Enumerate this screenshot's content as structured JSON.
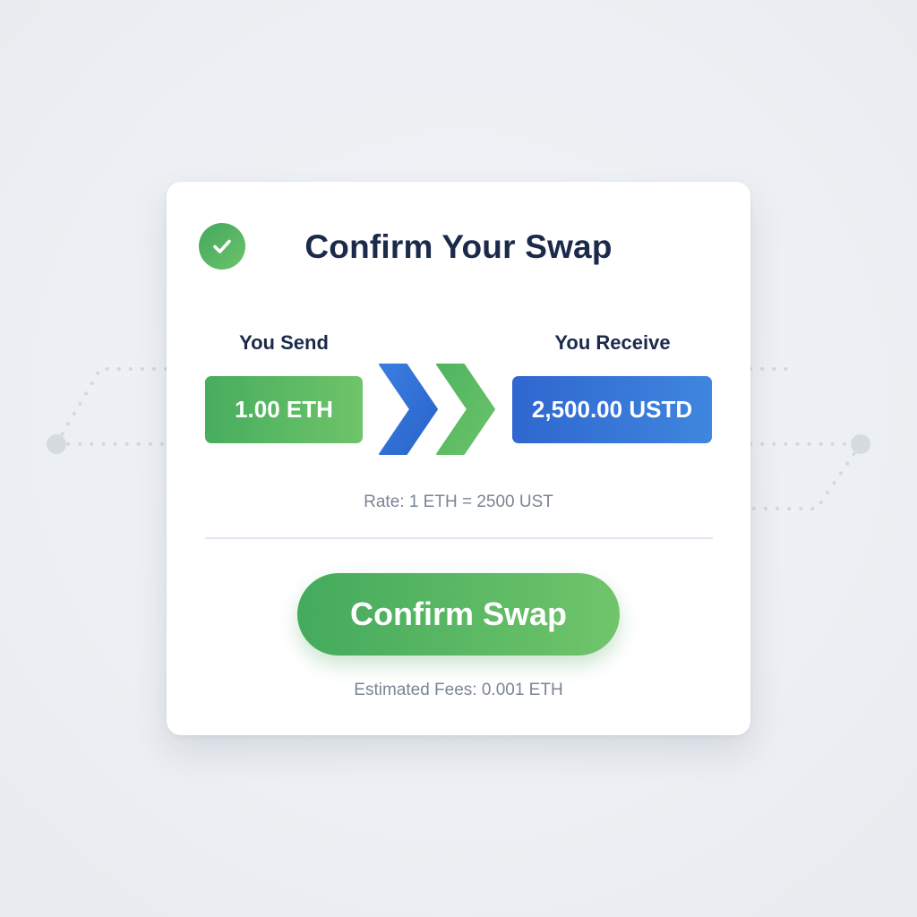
{
  "dialog": {
    "title": "Confirm Your Swap",
    "send_label": "You Send",
    "send_value": "1.00 ETH",
    "receive_label": "You Receive",
    "receive_value": "2,500.00 USTD",
    "rate_text": "Rate: 1 ETH = 2500 UST",
    "confirm_button_label": "Confirm Swap",
    "fees_text": "Estimated Fees: 0.001 ETH"
  },
  "icons": {
    "badge": "check-circle-icon",
    "swap_arrows": "double-chevron-right-icon"
  },
  "colors": {
    "accent_green": "#4caf50",
    "accent_blue": "#3374d6",
    "title_text": "#1b2a4a",
    "muted_text": "#7b8594"
  }
}
